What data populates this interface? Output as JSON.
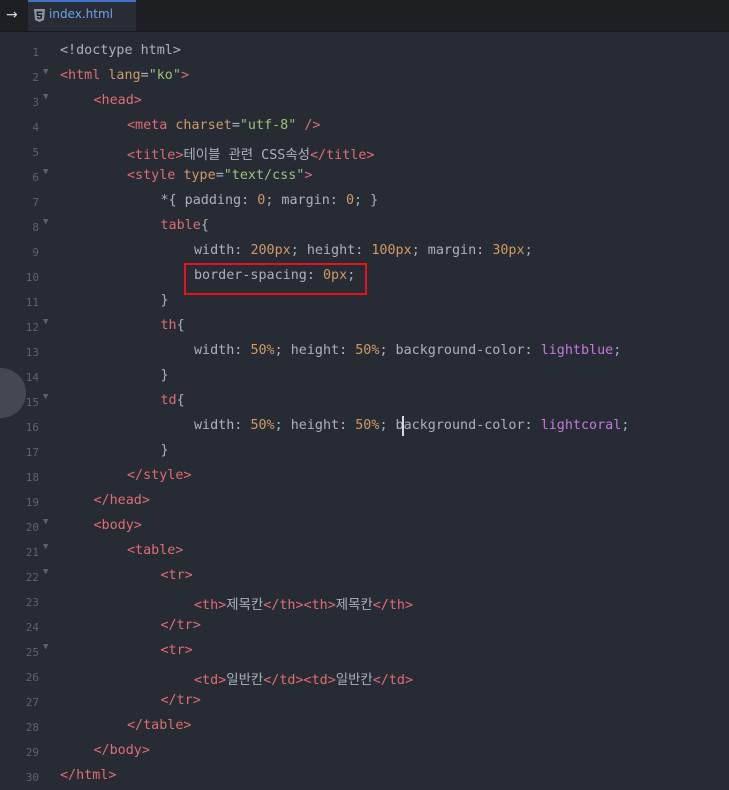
{
  "tab": {
    "filename": "index.html",
    "nav_arrow": "→"
  },
  "lines": [
    {
      "n": "1",
      "fold": false,
      "indent": 0,
      "tokens": [
        [
          "p",
          "<!doctype html>"
        ]
      ]
    },
    {
      "n": "2",
      "fold": true,
      "indent": 0,
      "tokens": [
        [
          "t",
          "<html "
        ],
        [
          "a",
          "lang"
        ],
        [
          "p",
          "="
        ],
        [
          "s",
          "\"ko\""
        ],
        [
          "t",
          ">"
        ]
      ]
    },
    {
      "n": "3",
      "fold": true,
      "indent": 1,
      "tokens": [
        [
          "t",
          "<head>"
        ]
      ]
    },
    {
      "n": "4",
      "fold": false,
      "indent": 2,
      "tokens": [
        [
          "t",
          "<meta "
        ],
        [
          "a",
          "charset"
        ],
        [
          "p",
          "="
        ],
        [
          "s",
          "\"utf-8\""
        ],
        [
          "t",
          " />"
        ]
      ]
    },
    {
      "n": "5",
      "fold": false,
      "indent": 2,
      "tokens": [
        [
          "t",
          "<title>"
        ],
        [
          "p",
          "테이블 관련 CSS속성"
        ],
        [
          "t",
          "</title>"
        ]
      ]
    },
    {
      "n": "6",
      "fold": true,
      "indent": 2,
      "tokens": [
        [
          "t",
          "<style "
        ],
        [
          "a",
          "type"
        ],
        [
          "p",
          "="
        ],
        [
          "s",
          "\"text/css\""
        ],
        [
          "t",
          ">"
        ]
      ]
    },
    {
      "n": "7",
      "fold": false,
      "indent": 3,
      "tokens": [
        [
          "p",
          "*{ padding: "
        ],
        [
          "num",
          "0"
        ],
        [
          "p",
          "; margin: "
        ],
        [
          "num",
          "0"
        ],
        [
          "p",
          "; }"
        ]
      ]
    },
    {
      "n": "8",
      "fold": true,
      "indent": 3,
      "tokens": [
        [
          "t",
          "table"
        ],
        [
          "p",
          "{"
        ]
      ]
    },
    {
      "n": "9",
      "fold": false,
      "indent": 4,
      "tokens": [
        [
          "p",
          "width: "
        ],
        [
          "num",
          "200px"
        ],
        [
          "p",
          "; height: "
        ],
        [
          "num",
          "100px"
        ],
        [
          "p",
          "; margin: "
        ],
        [
          "num",
          "30px"
        ],
        [
          "p",
          ";"
        ]
      ]
    },
    {
      "n": "10",
      "fold": false,
      "indent": 4,
      "tokens": [
        [
          "p",
          "border-spacing: "
        ],
        [
          "num",
          "0px"
        ],
        [
          "p",
          ";"
        ]
      ]
    },
    {
      "n": "11",
      "fold": false,
      "indent": 3,
      "tokens": [
        [
          "p",
          "}"
        ]
      ]
    },
    {
      "n": "12",
      "fold": true,
      "indent": 3,
      "tokens": [
        [
          "t",
          "th"
        ],
        [
          "p",
          "{"
        ]
      ]
    },
    {
      "n": "13",
      "fold": false,
      "indent": 4,
      "tokens": [
        [
          "p",
          "width: "
        ],
        [
          "num",
          "50%"
        ],
        [
          "p",
          "; height: "
        ],
        [
          "num",
          "50%"
        ],
        [
          "p",
          "; background-color: "
        ],
        [
          "v",
          "lightblue"
        ],
        [
          "p",
          ";"
        ]
      ]
    },
    {
      "n": "14",
      "fold": false,
      "indent": 3,
      "tokens": [
        [
          "p",
          "}"
        ]
      ]
    },
    {
      "n": "15",
      "fold": true,
      "indent": 3,
      "tokens": [
        [
          "t",
          "td"
        ],
        [
          "p",
          "{"
        ]
      ]
    },
    {
      "n": "16",
      "fold": false,
      "indent": 4,
      "tokens": [
        [
          "p",
          "width: "
        ],
        [
          "num",
          "50%"
        ],
        [
          "p",
          "; height: "
        ],
        [
          "num",
          "50%"
        ],
        [
          "p",
          "; background-color: "
        ],
        [
          "v",
          "lightcoral"
        ],
        [
          "p",
          ";"
        ]
      ]
    },
    {
      "n": "17",
      "fold": false,
      "indent": 3,
      "tokens": [
        [
          "p",
          "}"
        ]
      ]
    },
    {
      "n": "18",
      "fold": false,
      "indent": 2,
      "tokens": [
        [
          "t",
          "</style>"
        ]
      ]
    },
    {
      "n": "19",
      "fold": false,
      "indent": 1,
      "tokens": [
        [
          "t",
          "</head>"
        ]
      ]
    },
    {
      "n": "20",
      "fold": true,
      "indent": 1,
      "tokens": [
        [
          "t",
          "<body>"
        ]
      ]
    },
    {
      "n": "21",
      "fold": true,
      "indent": 2,
      "tokens": [
        [
          "t",
          "<table>"
        ]
      ]
    },
    {
      "n": "22",
      "fold": true,
      "indent": 3,
      "tokens": [
        [
          "t",
          "<tr>"
        ]
      ]
    },
    {
      "n": "23",
      "fold": false,
      "indent": 4,
      "tokens": [
        [
          "t",
          "<th>"
        ],
        [
          "p",
          "제목칸"
        ],
        [
          "t",
          "</th>"
        ],
        [
          "t",
          "<th>"
        ],
        [
          "p",
          "제목칸"
        ],
        [
          "t",
          "</th>"
        ]
      ]
    },
    {
      "n": "24",
      "fold": false,
      "indent": 3,
      "tokens": [
        [
          "t",
          "</tr>"
        ]
      ]
    },
    {
      "n": "25",
      "fold": true,
      "indent": 3,
      "tokens": [
        [
          "t",
          "<tr>"
        ]
      ]
    },
    {
      "n": "26",
      "fold": false,
      "indent": 4,
      "tokens": [
        [
          "t",
          "<td>"
        ],
        [
          "p",
          "일반칸"
        ],
        [
          "t",
          "</td>"
        ],
        [
          "t",
          "<td>"
        ],
        [
          "p",
          "일반칸"
        ],
        [
          "t",
          "</td>"
        ]
      ]
    },
    {
      "n": "27",
      "fold": false,
      "indent": 3,
      "tokens": [
        [
          "t",
          "</tr>"
        ]
      ]
    },
    {
      "n": "28",
      "fold": false,
      "indent": 2,
      "tokens": [
        [
          "t",
          "</table>"
        ]
      ]
    },
    {
      "n": "29",
      "fold": false,
      "indent": 1,
      "tokens": [
        [
          "t",
          "</body>"
        ]
      ]
    },
    {
      "n": "30",
      "fold": false,
      "indent": 0,
      "tokens": [
        [
          "t",
          "</html>"
        ]
      ]
    }
  ],
  "colors": {
    "highlight_box": "#e5141c",
    "tab_accent": "#3f73c8",
    "background": "#272b33"
  },
  "icons": {
    "file_icon": "html5-icon",
    "nav": "arrow-right-icon"
  }
}
